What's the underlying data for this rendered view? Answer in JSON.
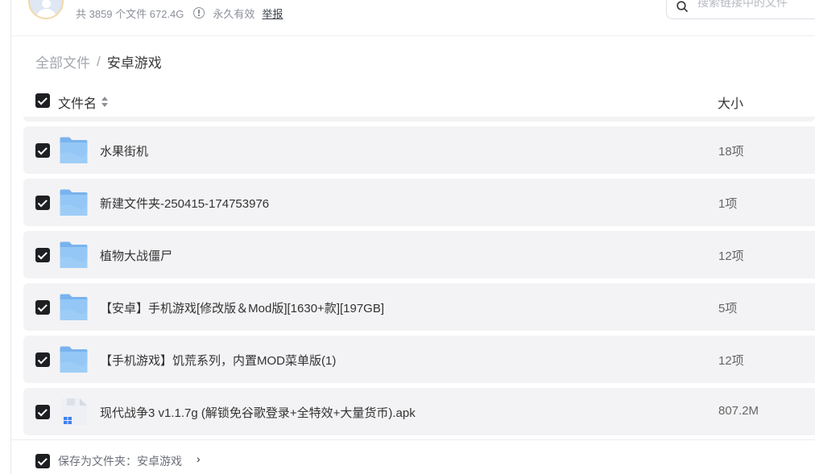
{
  "header": {
    "meta_text": "共 3859 个文件 672.4G",
    "validity": "永久有效",
    "report_label": "举报",
    "search_placeholder": "搜索链接中的文件"
  },
  "breadcrumb": {
    "root": "全部文件",
    "separator": "/",
    "current": "安卓游戏"
  },
  "table": {
    "col_name": "文件名",
    "col_size": "大小",
    "rows": [
      {
        "name": "水果街机",
        "size": "18项",
        "type": "folder",
        "checked": true
      },
      {
        "name": "新建文件夹-250415-174753976",
        "size": "1项",
        "type": "folder",
        "checked": true
      },
      {
        "name": "植物大战僵尸",
        "size": "12项",
        "type": "folder",
        "checked": true
      },
      {
        "name": "【安卓】手机游戏[修改版＆Mod版][1630+款][197GB]",
        "size": "5项",
        "type": "folder",
        "checked": true
      },
      {
        "name": "【手机游戏】饥荒系列，内置MOD菜单版(1)",
        "size": "12项",
        "type": "folder",
        "checked": true
      },
      {
        "name": "现代战争3 v1.1.7g (解锁免谷歌登录+全特效+大量货币).apk",
        "size": "807.2M",
        "type": "apk",
        "checked": true
      }
    ]
  },
  "footer": {
    "save_label": "保存为文件夹：安卓游戏",
    "chevron": "›"
  },
  "colors": {
    "folder": "#8cc2f3",
    "checkbox": "#1e1f23",
    "row_bg": "#f3f3f5"
  }
}
